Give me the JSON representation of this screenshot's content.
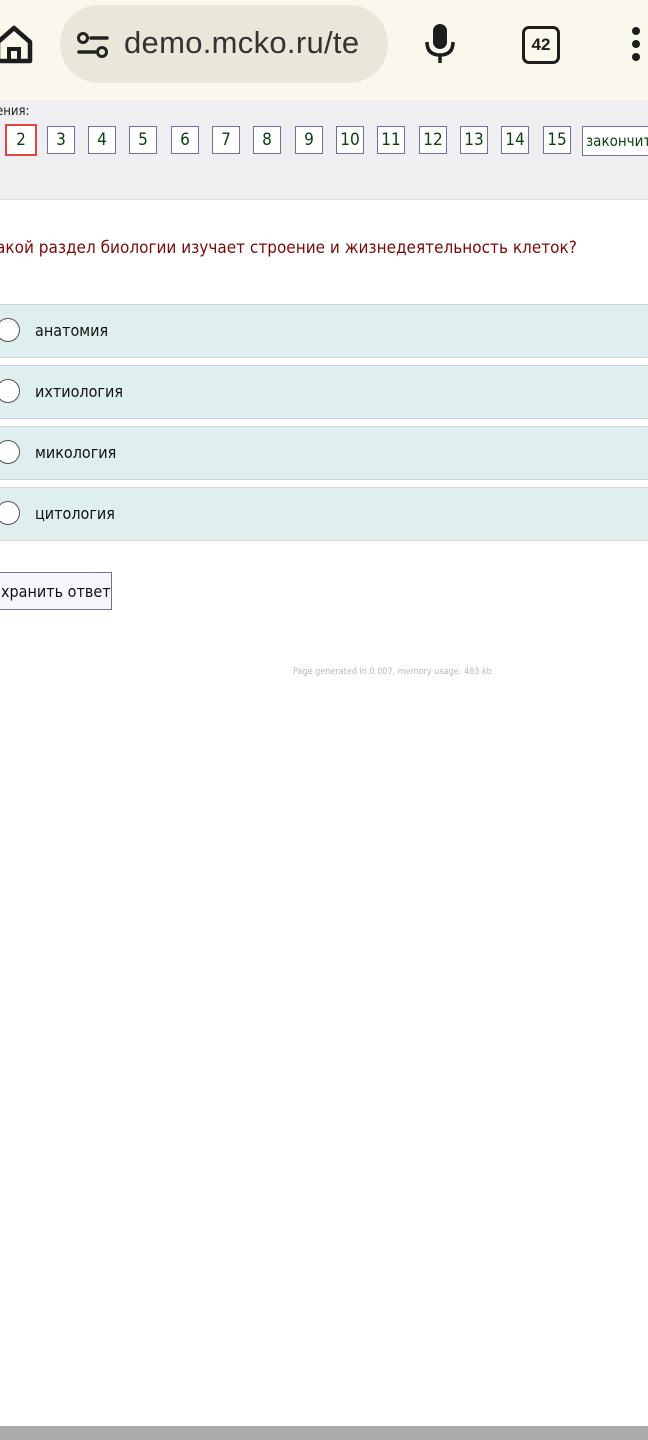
{
  "browser": {
    "url": "demo.mcko.ru/te",
    "tab_count": "42"
  },
  "nav": {
    "caption": "ения:",
    "current": "2",
    "numbers": [
      "2",
      "3",
      "4",
      "5",
      "6",
      "7",
      "8",
      "9",
      "10",
      "11",
      "12",
      "13",
      "14",
      "15"
    ],
    "finish_label": "закончить"
  },
  "question": {
    "text": "акой раздел биологии изучает строение и жизнедеятельность клеток?",
    "options": [
      "анатомия",
      "ихтиология",
      "микология",
      "цитология"
    ]
  },
  "save_label": "хранить ответ",
  "footer": "Page generated in 0.007, memory usage: 483 kb",
  "colors": {
    "question_text": "#7a0a0a",
    "option_bg": "#dfeeee",
    "current_border": "#e0463f",
    "nav_bg": "#efeff1"
  },
  "icons": {
    "home": "home-icon",
    "site_settings": "tune-icon",
    "mic": "mic-icon",
    "menu": "more-vert-icon"
  }
}
